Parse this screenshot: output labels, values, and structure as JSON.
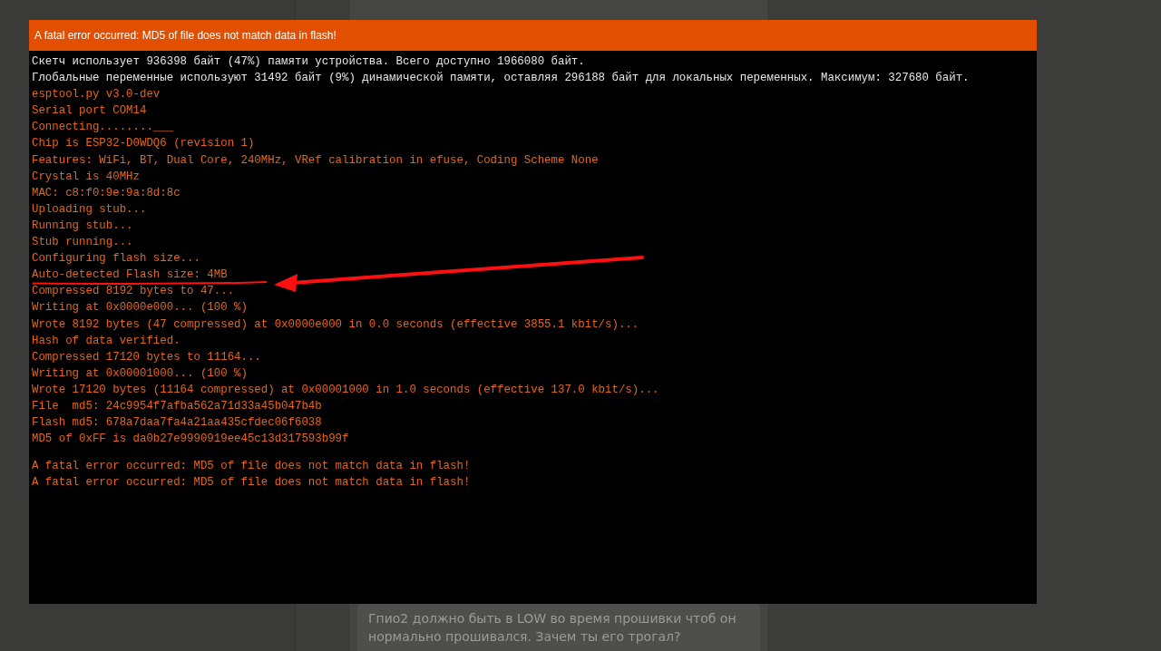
{
  "dialog": {
    "title": "A fatal error occurred: MD5 of file does not match data in flash!"
  },
  "console": {
    "blocks": [
      {
        "lines": [
          {
            "kind": "info",
            "text": "Скетч использует 936398 байт (47%) памяти устройства. Всего доступно 1966080 байт."
          },
          {
            "kind": "info",
            "text": "Глобальные переменные используют 31492 байт (9%) динамической памяти, оставляя 296188 байт для локальных переменных. Максимум: 327680 байт."
          },
          {
            "kind": "log",
            "text": "esptool.py v3.0-dev"
          },
          {
            "kind": "log",
            "text": "Serial port COM14"
          },
          {
            "kind": "log",
            "text": "Connecting........___"
          },
          {
            "kind": "log",
            "text": "Chip is ESP32-D0WDQ6 (revision 1)"
          },
          {
            "kind": "log",
            "text": "Features: WiFi, BT, Dual Core, 240MHz, VRef calibration in efuse, Coding Scheme None"
          },
          {
            "kind": "log",
            "text": "Crystal is 40MHz"
          },
          {
            "kind": "log",
            "text": "MAC: c8:f0:9e:9a:8d:8c"
          },
          {
            "kind": "log",
            "text": "Uploading stub..."
          },
          {
            "kind": "log",
            "text": "Running stub..."
          },
          {
            "kind": "log",
            "text": "Stub running..."
          },
          {
            "kind": "log",
            "text": "Configuring flash size..."
          },
          {
            "kind": "log",
            "text": "Auto-detected Flash size: 4MB"
          },
          {
            "kind": "log",
            "text": "Compressed 8192 bytes to 47..."
          },
          {
            "kind": "log",
            "text": "Writing at 0x0000e000... (100 %)"
          },
          {
            "kind": "log",
            "text": "Wrote 8192 bytes (47 compressed) at 0x0000e000 in 0.0 seconds (effective 3855.1 kbit/s)..."
          },
          {
            "kind": "log",
            "text": "Hash of data verified."
          },
          {
            "kind": "log",
            "text": "Compressed 17120 bytes to 11164..."
          },
          {
            "kind": "log",
            "text": "Writing at 0x00001000... (100 %)"
          },
          {
            "kind": "log",
            "text": "Wrote 17120 bytes (11164 compressed) at 0x00001000 in 1.0 seconds (effective 137.0 kbit/s)..."
          },
          {
            "kind": "log",
            "text": "File  md5: 24c9954f7afba562a71d33a45b047b4b"
          },
          {
            "kind": "log",
            "text": "Flash md5: 678a7daa7fa4a21aa435cfdec06f6038"
          },
          {
            "kind": "log",
            "text": "MD5 of 0xFF is da0b27e9990919ee45c13d317593b99f"
          }
        ]
      },
      {
        "lines": [
          {
            "kind": "log",
            "text": "A fatal error occurred: MD5 of file does not match data in flash!"
          },
          {
            "kind": "log",
            "text": "A fatal error occurred: MD5 of file does not match data in flash!"
          }
        ]
      }
    ]
  },
  "chat": {
    "message": "Гпио2 должно быть в LOW во время прошивки чтоб он нормально прошивался. Зачем ты его трогал?"
  }
}
